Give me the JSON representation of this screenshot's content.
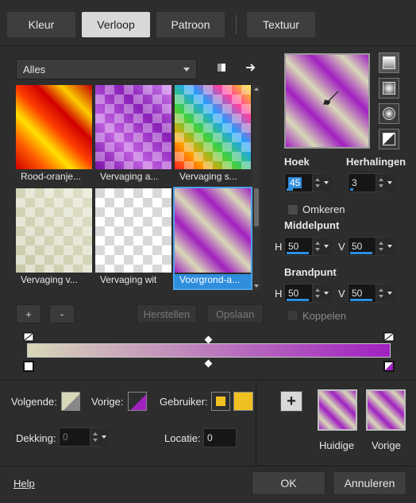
{
  "tabs": [
    {
      "label": "Kleur",
      "active": false
    },
    {
      "label": "Verloop",
      "active": true
    },
    {
      "label": "Patroon",
      "active": false
    },
    {
      "label": "Textuur",
      "active": false
    }
  ],
  "library": {
    "filter_value": "Alles",
    "gradients": [
      {
        "label": "Rood-oranje..."
      },
      {
        "label": "Vervaging a..."
      },
      {
        "label": "Vervaging s..."
      },
      {
        "label": "Vervaging v..."
      },
      {
        "label": "Vervaging wit"
      },
      {
        "label": "Voorgrond-a...",
        "selected": true
      }
    ],
    "add_label": "+",
    "remove_label": "-",
    "reset_label": "Herstellen",
    "save_label": "Opslaan"
  },
  "settings": {
    "angle_label": "Hoek",
    "angle_value": "45",
    "repeats_label": "Herhalingen",
    "repeats_value": "3",
    "invert_label": "Omkeren",
    "midpoint_label": "Middelpunt",
    "midpoint_h_label": "H",
    "midpoint_h_value": "50",
    "midpoint_v_label": "V",
    "midpoint_v_value": "50",
    "focal_label": "Brandpunt",
    "focal_h_label": "H",
    "focal_h_value": "50",
    "focal_v_label": "V",
    "focal_v_value": "50",
    "link_label": "Koppelen"
  },
  "stops": {
    "next_label": "Volgende:",
    "prev_label": "Vorige:",
    "user_label": "Gebruiker:",
    "opacity_label": "Dekking:",
    "opacity_value": "0",
    "location_label": "Locatie:",
    "location_value": "0"
  },
  "compare": {
    "add_label": "+",
    "current_label": "Huidige",
    "previous_label": "Vorige"
  },
  "footer": {
    "help_label": "Help",
    "ok_label": "OK",
    "cancel_label": "Annuleren"
  },
  "colors": {
    "accent": "#2f8ede",
    "purple": "#a020c0",
    "beige": "#d8d8b8",
    "gold": "#f0c020"
  }
}
